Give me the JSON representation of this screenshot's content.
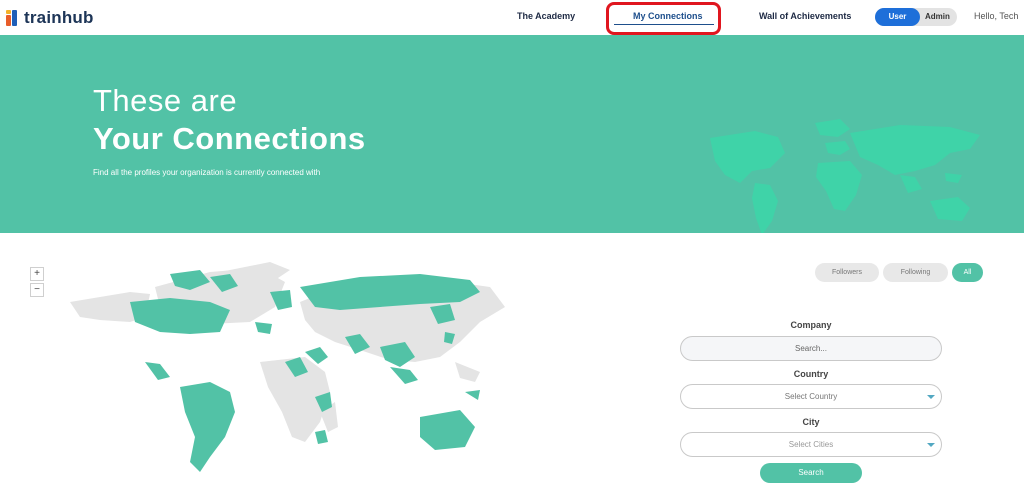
{
  "brand": {
    "name": "trainhub"
  },
  "nav": {
    "academy": "The Academy",
    "connections": "My Connections",
    "wall": "Wall of Achievements"
  },
  "role": {
    "user": "User",
    "admin": "Admin"
  },
  "greeting": "Hello, Tech",
  "hero": {
    "line1": "These are",
    "line2": "Your Connections",
    "subtitle": "Find all the profiles your organization is currently connected with"
  },
  "map_controls": {
    "zoom_in": "+",
    "zoom_out": "−"
  },
  "filters": {
    "followers": "Followers",
    "following": "Following",
    "all": "All",
    "active": "All"
  },
  "form": {
    "company_label": "Company",
    "company_placeholder": "Search...",
    "country_label": "Country",
    "country_value": "Select Country",
    "city_label": "City",
    "city_value": "Select Cities",
    "search_button": "Search"
  },
  "colors": {
    "accent": "#52c2a6",
    "nav_active": "#1e4f8c",
    "highlight": "#e0161f",
    "user_toggle": "#1e6fd9",
    "map_land": "#e4e4e4",
    "map_connected": "#52c2a6"
  },
  "icons": [
    "trainhub-logo-icon",
    "chevron-down-icon",
    "zoom-in-icon",
    "zoom-out-icon",
    "world-map-icon"
  ]
}
